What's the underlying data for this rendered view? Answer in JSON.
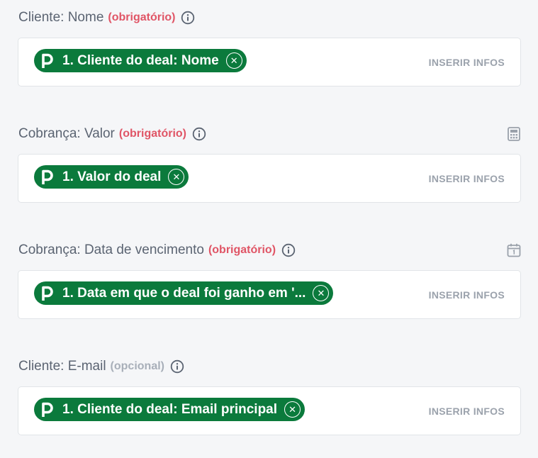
{
  "fields": [
    {
      "label": "Cliente: Nome",
      "tag": "(obrigatório)",
      "tag_type": "required",
      "side_icon": null,
      "pill_text": "1. Cliente do deal: Nome",
      "insert_label": "INSERIR INFOS"
    },
    {
      "label": "Cobrança: Valor",
      "tag": "(obrigatório)",
      "tag_type": "required",
      "side_icon": "calculator-icon",
      "pill_text": "1. Valor do deal",
      "insert_label": "INSERIR INFOS"
    },
    {
      "label": "Cobrança: Data de vencimento",
      "tag": "(obrigatório)",
      "tag_type": "required",
      "side_icon": "calendar-icon",
      "pill_text": "1. Data em que o deal foi ganho em '...",
      "insert_label": "INSERIR INFOS"
    },
    {
      "label": "Cliente: E-mail",
      "tag": "(opcional)",
      "tag_type": "optional",
      "side_icon": null,
      "pill_text": "1. Cliente do deal: Email principal",
      "insert_label": "INSERIR INFOS"
    }
  ],
  "colors": {
    "background": "#f5f6f8",
    "label": "#5b6472",
    "required": "#e05566",
    "optional": "#a8afb9",
    "pill": "#0b7a3c",
    "insert": "#9ba2ac"
  },
  "icons": {
    "info": "info-circle-icon",
    "pill_logo": "pipedrive-p-icon",
    "pill_remove": "close-circle-icon"
  }
}
